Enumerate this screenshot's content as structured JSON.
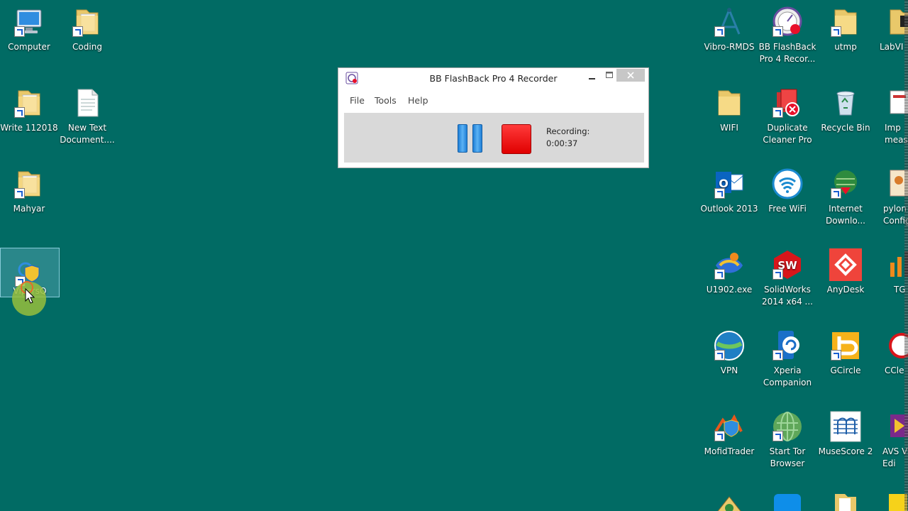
{
  "desktop": {
    "background": "#016b64",
    "icons": {
      "computer": "Computer",
      "coding": "Coding",
      "write": "Write 112018",
      "newtext": "New Text\nDocument....",
      "mahyar": "Mahyar",
      "vipers": "VipersQ",
      "vibro": "Vibro-RMDS",
      "flashback": "BB FlashBack\nPro 4 Recor...",
      "utmp": "utmp",
      "labview": "LabVI",
      "wifi": "WIFI",
      "duplicate": "Duplicate\nCleaner Pro",
      "recycle": "Recycle Bin",
      "imp": "Imp\nmeasu",
      "outlook": "Outlook 2013",
      "freewifi": "Free WiFi",
      "idm": "Internet\nDownlo...",
      "pylon": "pylon\nConfig",
      "u1902": "U1902.exe",
      "solidworks": "SolidWorks\n2014 x64 ...",
      "anydesk": "AnyDesk",
      "tg": "TG",
      "vpn": "VPN",
      "xperia": "Xperia\nCompanion",
      "gcircle": "GCircle",
      "ccleaner": "CCle",
      "mofid": "MofidTrader",
      "tor": "Start Tor\nBrowser",
      "musescore": "MuseScore 2",
      "avs": "AVS V\nEdi"
    }
  },
  "recorder": {
    "title": "BB FlashBack Pro 4 Recorder",
    "menu": [
      "File",
      "Tools",
      "Help"
    ],
    "recording_label": "Recording:",
    "recording_time": "0:00:37",
    "colors": {
      "pause": "#2a8ae0",
      "stop": "#ff1f1f"
    }
  }
}
